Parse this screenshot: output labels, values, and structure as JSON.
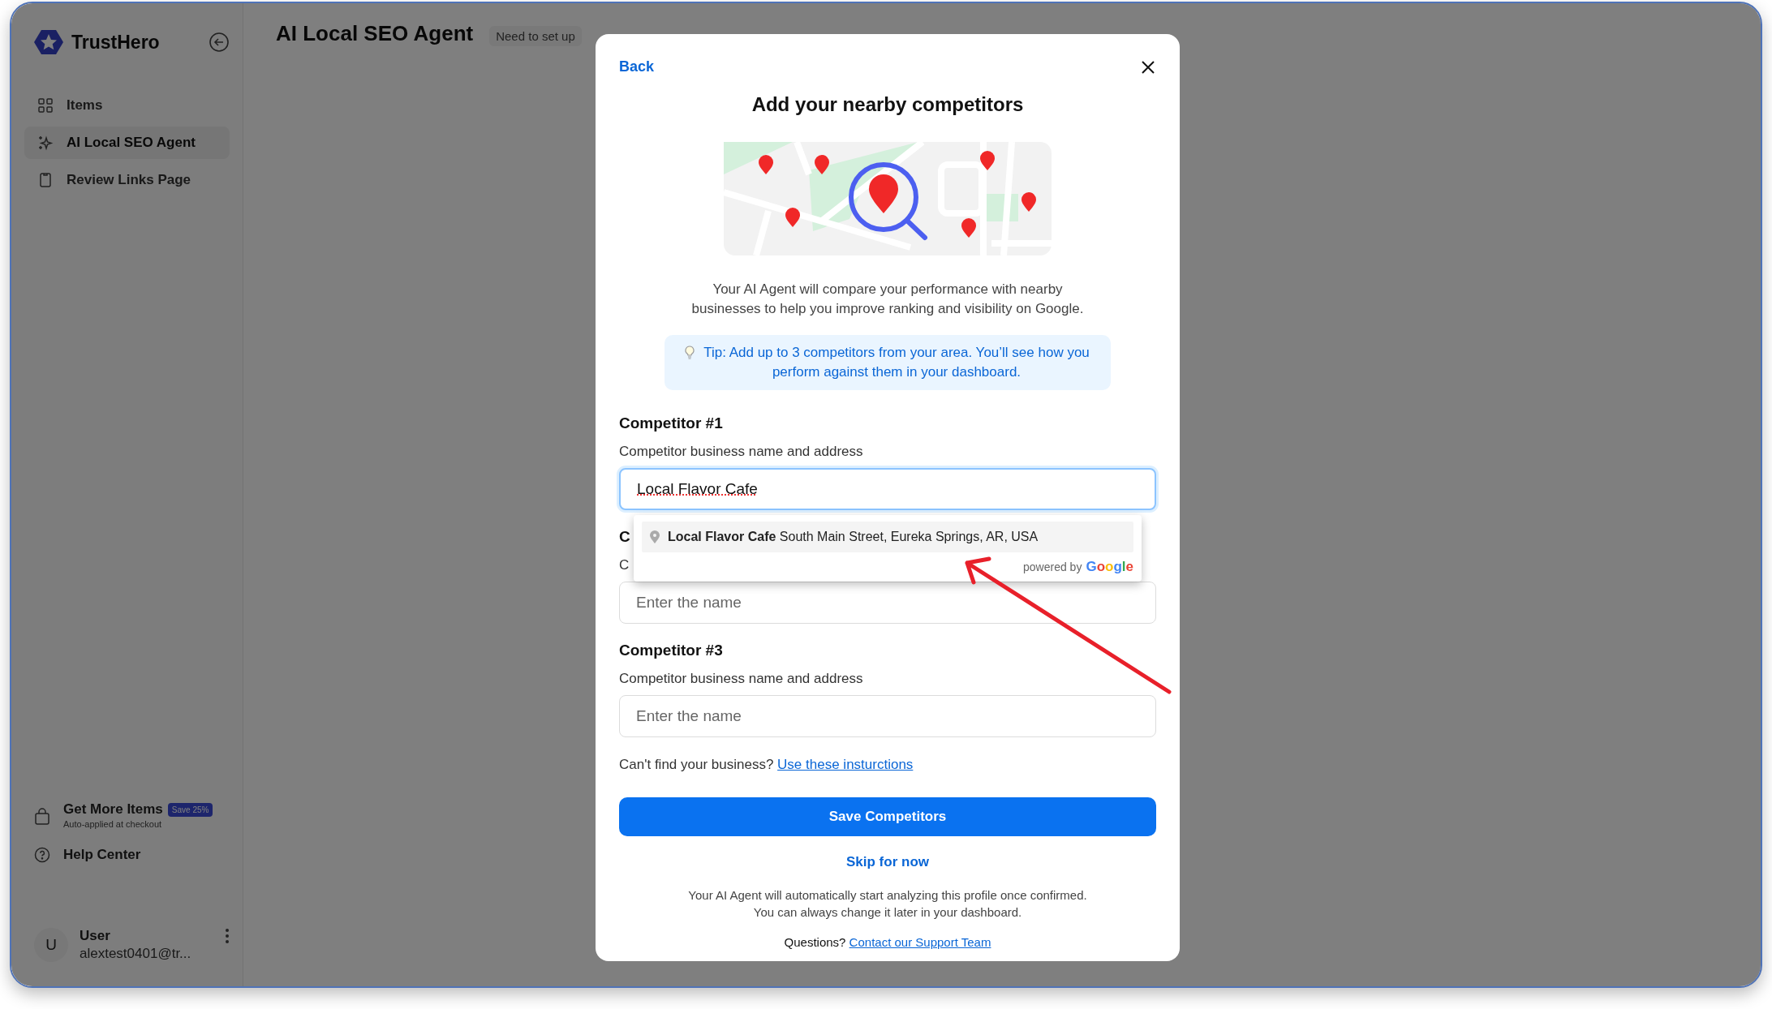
{
  "sidebar": {
    "brand": "TrustHero",
    "nav": [
      {
        "label": "Items",
        "kind": "grid",
        "selected": false
      },
      {
        "label": "AI Local SEO Agent",
        "kind": "sparkle",
        "selected": true
      },
      {
        "label": "Review Links Page",
        "kind": "page",
        "selected": false
      }
    ],
    "promo": {
      "title": "Get More Items",
      "badge": "Save 25%",
      "subtitle": "Auto-applied at checkout"
    },
    "help": "Help Center",
    "user": {
      "initial": "U",
      "name": "User",
      "email": "alextest0401@tr..."
    }
  },
  "header": {
    "title": "AI Local SEO Agent",
    "status": "Need to set up"
  },
  "modal": {
    "back": "Back",
    "title": "Add your nearby competitors",
    "description": "Your AI Agent will compare your performance with nearby businesses to help you improve ranking and visibility on Google.",
    "tip": "Tip: Add up to 3 competitors from your area. You’ll see how you perform against them in your dashboard.",
    "competitors": [
      {
        "heading": "Competitor #1",
        "label": "Competitor business name and address",
        "value": "Local Flavor Cafe",
        "focused": true
      },
      {
        "heading": "C",
        "label": "C",
        "placeholder": "Enter the name",
        "focused": false
      },
      {
        "heading": "Competitor #3",
        "label": "Competitor business name and address",
        "placeholder": "Enter the name",
        "focused": false
      }
    ],
    "suggestion": {
      "name": "Local Flavor Cafe",
      "address": "South Main Street, Eureka Springs, AR, USA",
      "attribution": "powered by",
      "brand": "Google"
    },
    "help_text": "Can't find your business?",
    "help_link": "Use these insturctions",
    "save": "Save Competitors",
    "skip": "Skip for now",
    "footer": [
      "Your AI Agent will automatically start analyzing this profile once confirmed.",
      "You can always change it later in your dashboard."
    ],
    "questions": "Questions?",
    "support_link": "Contact our Support Team"
  }
}
